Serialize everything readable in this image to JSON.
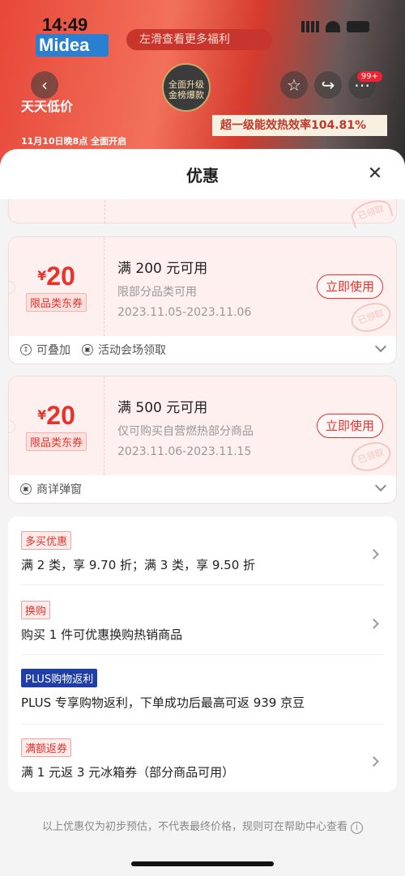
{
  "status_bar": {
    "time": "14:49"
  },
  "banner": {
    "brand": "Midea",
    "promo_hint": "左滑查看更多福利",
    "event": "天天低价",
    "event_sub": "11月10日晚8点 全面开启",
    "grade_badge": "全面升级 金榜爆款",
    "efficiency": "超一级能效热效率104.81%",
    "cart_badge": "99+"
  },
  "sheet": {
    "title": "优惠",
    "stamp_label": "已领取"
  },
  "coupons": [
    {
      "currency": "¥",
      "amount": "20",
      "type": "限品类东券",
      "condition": "满 200 元可用",
      "scope": "限部分品类可用",
      "date": "2023.11.05-2023.11.06",
      "button": "立即使用",
      "tags": [
        "可叠加",
        "活动会场领取"
      ]
    },
    {
      "currency": "¥",
      "amount": "20",
      "type": "限品类东券",
      "condition": "满 500 元可用",
      "scope": "仅可购买自营燃热部分商品",
      "date": "2023.11.06-2023.11.15",
      "button": "立即使用",
      "tags": [
        "商详弹窗"
      ]
    }
  ],
  "promotions": [
    {
      "tag": "多买优惠",
      "text": "满 2 类，享 9.70 折；满 3 类，享 9.50 折"
    },
    {
      "tag": "换购",
      "text": "购买 1 件可优惠换购热销商品"
    },
    {
      "tag": "PLUS购物返利",
      "text": "PLUS 专享购物返利，下单成功后最高可返 939 京豆"
    },
    {
      "tag": "满额返券",
      "text": "满 1 元返 3 元冰箱券（部分商品可用）"
    }
  ],
  "footnote": "以上优惠仅为初步预估，不代表最终价格，规则可在帮助中心查看"
}
